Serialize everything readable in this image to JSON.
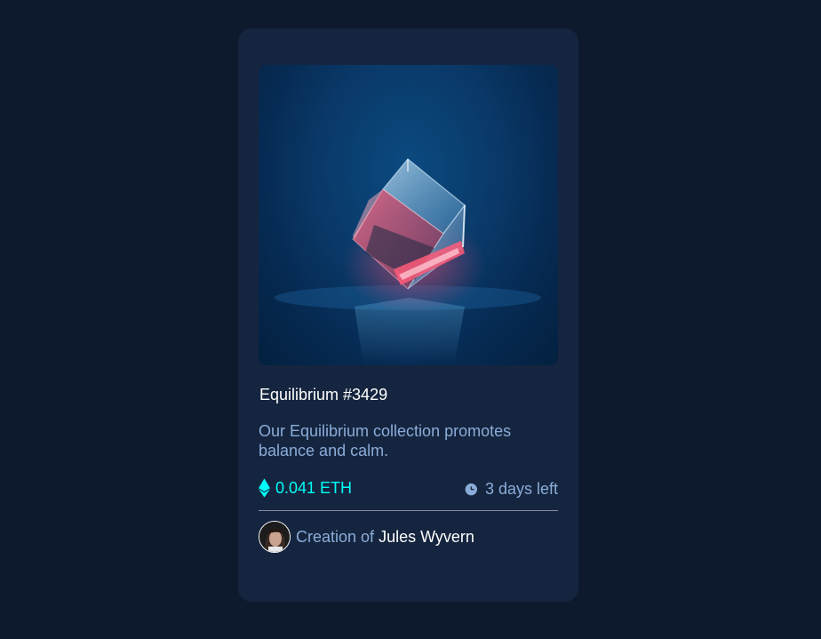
{
  "card": {
    "image": {
      "alt": "Equilibrium"
    },
    "title": "Equilibrium #3429",
    "description": "Our Equilibrium collection promotes balance and calm.",
    "price": {
      "value": "0.041 ETH",
      "icon": "ethereum-icon"
    },
    "time": {
      "value": "3 days left",
      "icon": "clock-icon"
    },
    "creator": {
      "prefix": "Creation of",
      "name": "Jules Wyvern"
    }
  },
  "colors": {
    "background": "#0d1a2e",
    "card": "#15253f",
    "cyan": "#00fff8",
    "soft_blue": "#8bacd9",
    "white": "#ffffff"
  }
}
